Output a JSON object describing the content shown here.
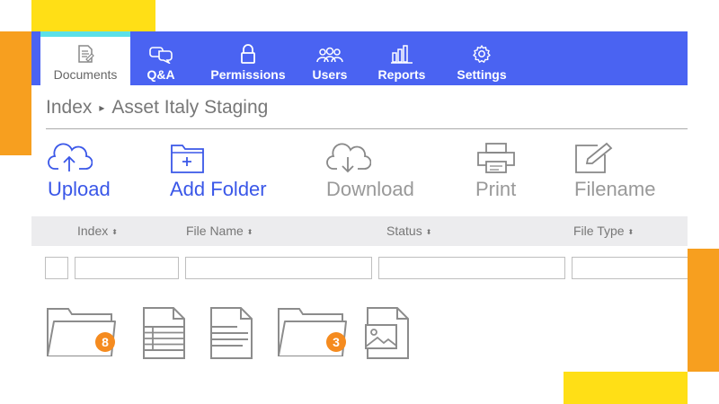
{
  "nav": {
    "tabs": [
      {
        "label": "Documents",
        "icon": "document-icon",
        "active": true
      },
      {
        "label": "Q&A",
        "icon": "chat-icon",
        "active": false
      },
      {
        "label": "Permissions",
        "icon": "lock-icon",
        "active": false
      },
      {
        "label": "Users",
        "icon": "users-icon",
        "active": false
      },
      {
        "label": "Reports",
        "icon": "bar-chart-icon",
        "active": false
      },
      {
        "label": "Settings",
        "icon": "gear-icon",
        "active": false
      }
    ]
  },
  "breadcrumb": {
    "root": "Index",
    "current": "Asset Italy Staging"
  },
  "toolbar": {
    "upload": "Upload",
    "add_folder": "Add Folder",
    "download": "Download",
    "print": "Print",
    "filename": "Filename"
  },
  "table": {
    "columns": [
      "Index",
      "File Name",
      "Status",
      "File Type"
    ],
    "sort_glyph": "⬍"
  },
  "files": [
    {
      "type": "folder",
      "icon": "folder-icon",
      "count": "8"
    },
    {
      "type": "spreadsheet",
      "icon": "spreadsheet-file-icon"
    },
    {
      "type": "text",
      "icon": "text-file-icon"
    },
    {
      "type": "folder",
      "icon": "folder-icon",
      "count": "3"
    },
    {
      "type": "image",
      "icon": "image-file-icon"
    }
  ],
  "colors": {
    "nav_bg": "#4a63f2",
    "accent_blue": "#3a57e8",
    "badge_orange": "#f58b1f",
    "deco_yellow": "#ffdf16",
    "deco_orange": "#f79f1f",
    "active_tab_border": "#5ce0e8"
  }
}
